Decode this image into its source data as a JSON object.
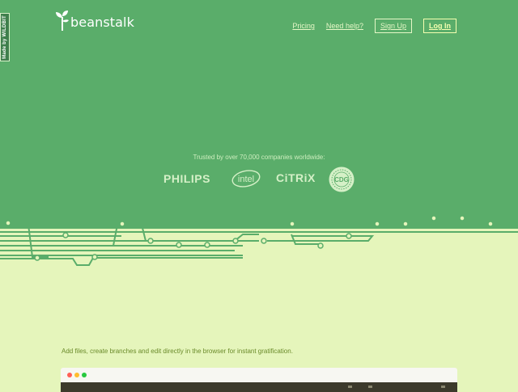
{
  "badge": {
    "text": "Made by WILDBIT"
  },
  "brand": {
    "name": "beanstalk"
  },
  "nav": {
    "pricing": "Pricing",
    "help": "Need help?",
    "signup": "Sign Up",
    "login": "Log In"
  },
  "trusted": {
    "text": "Trusted by over 70,000 companies worldwide:",
    "logos": {
      "philips": "PHILIPS",
      "intel": "intel",
      "citrix": "CiTRiX",
      "seal": "CDG"
    }
  },
  "tagline": "Add files, create branches and edit directly in the browser for instant gratification.",
  "colors": {
    "hero": "#5aad6a",
    "lower": "#e5f5bb",
    "track": "#5aad6a",
    "highlight": "#f5ffb0"
  },
  "browser": {
    "dots": [
      "#ff5f56",
      "#ffbd2e",
      "#27c93f"
    ]
  }
}
